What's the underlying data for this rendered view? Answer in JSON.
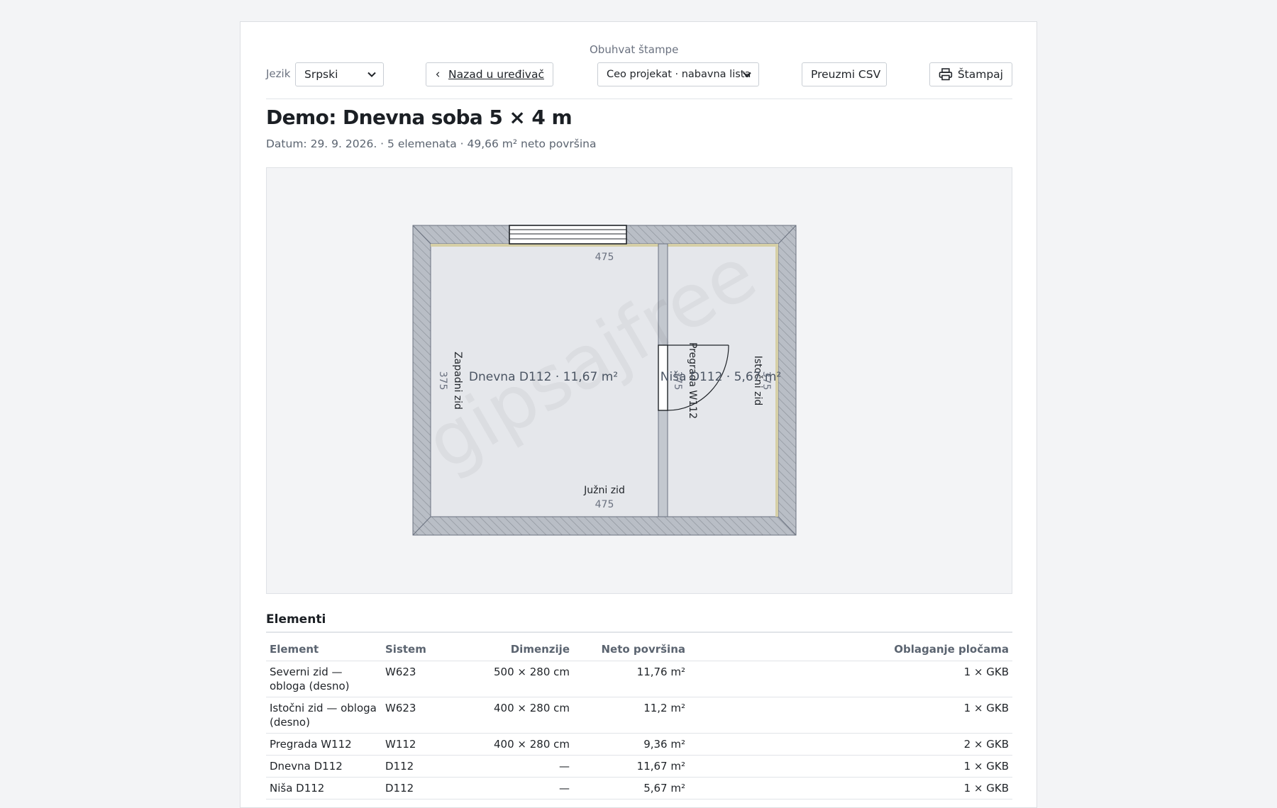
{
  "toolbar": {
    "language_label": "Jezik",
    "language_value": "Srpski",
    "back_label": "Nazad u uređivač",
    "scope_label": "Obuhvat štampe",
    "scope_value": "Ceo projekat · nabavna lista",
    "csv_label": "Preuzmi CSV",
    "print_label": "Štampaj"
  },
  "header": {
    "title": "Demo: Dnevna soba 5 × 4 m",
    "subtitle": "Datum: 29. 9. 2026. · 5 elemenata · 49,66 m² neto površina"
  },
  "plan": {
    "watermark": "gipsajfree",
    "dim_north": "475",
    "dim_south": "475",
    "dim_west": "375",
    "dim_east": "375",
    "dim_partition": "375",
    "label_south_wall": "Južni zid",
    "label_west_wall": "Zapadni zid",
    "label_east_wall": "Istočni zid",
    "label_partition": "Pregrada W112",
    "room_left": "Dnevna D112 · 11,67 m²",
    "room_right": "Niša D112 · 5,67 m²",
    "colors": {
      "wall_fill": "#b9bec6",
      "room_fill": "#e5e7eb",
      "lining": "#d6cfa6"
    }
  },
  "elements": {
    "heading": "Elementi",
    "columns": [
      "Element",
      "Sistem",
      "Dimenzije",
      "Neto površina",
      "Oblaganje pločama"
    ],
    "rows": [
      {
        "element": "Severni zid — obloga (desno)",
        "system": "W623",
        "dims": "500 × 280 cm",
        "area": "11,76 m²",
        "boards": "1 × GKB"
      },
      {
        "element": "Istočni zid — obloga (desno)",
        "system": "W623",
        "dims": "400 × 280 cm",
        "area": "11,2 m²",
        "boards": "1 × GKB"
      },
      {
        "element": "Pregrada W112",
        "system": "W112",
        "dims": "400 × 280 cm",
        "area": "9,36 m²",
        "boards": "2 × GKB"
      },
      {
        "element": "Dnevna D112",
        "system": "D112",
        "dims": "—",
        "area": "11,67 m²",
        "boards": "1 × GKB"
      },
      {
        "element": "Niša D112",
        "system": "D112",
        "dims": "—",
        "area": "5,67 m²",
        "boards": "1 × GKB"
      }
    ]
  }
}
